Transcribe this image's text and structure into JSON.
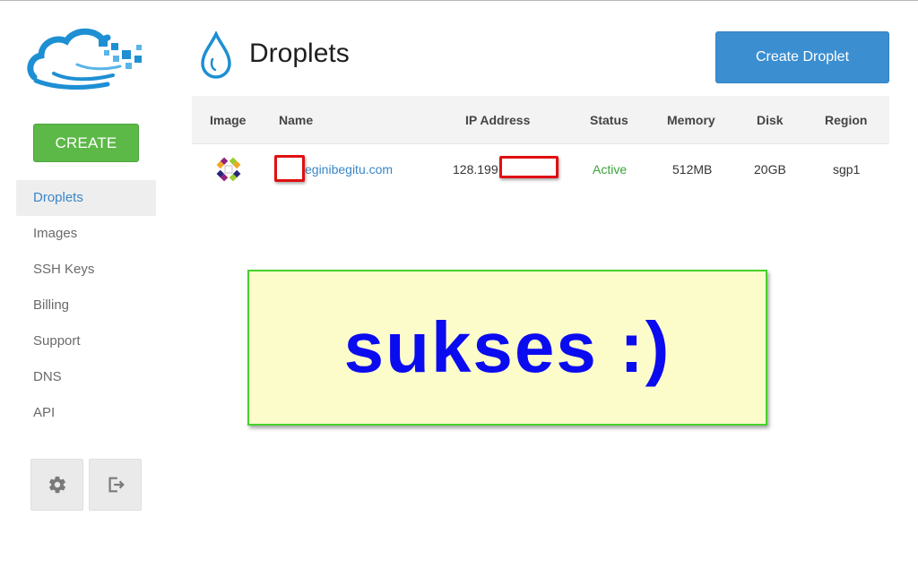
{
  "sidebar": {
    "create_label": "CREATE",
    "items": [
      {
        "label": "Droplets",
        "active": true
      },
      {
        "label": "Images"
      },
      {
        "label": "SSH Keys"
      },
      {
        "label": "Billing"
      },
      {
        "label": "Support"
      },
      {
        "label": "DNS"
      },
      {
        "label": "API"
      }
    ],
    "icons": {
      "settings": "gear-icon",
      "logout": "logout-icon",
      "logo": "digitalocean-cloud-logo"
    }
  },
  "header": {
    "title": "Droplets",
    "create_droplet_label": "Create Droplet",
    "icon": "water-drop-icon"
  },
  "table": {
    "headers": [
      "Image",
      "Name",
      "IP Address",
      "Status",
      "Memory",
      "Disk",
      "Region"
    ],
    "rows": [
      {
        "image_icon": "centos-icon",
        "name": "eginibegitu.com",
        "ip": "128.199",
        "status": "Active",
        "memory": "512MB",
        "disk": "20GB",
        "region": "sgp1"
      }
    ]
  },
  "banner": {
    "text": "sukses :)"
  },
  "colors": {
    "create_green": "#5cb847",
    "primary_blue": "#3b8fd1",
    "link_blue": "#3a86c8",
    "status_green": "#3aa33a",
    "banner_bg": "#fcfccb",
    "banner_border": "#46d12c",
    "banner_text": "#0b0bf0",
    "redact_red": "#e01010"
  }
}
